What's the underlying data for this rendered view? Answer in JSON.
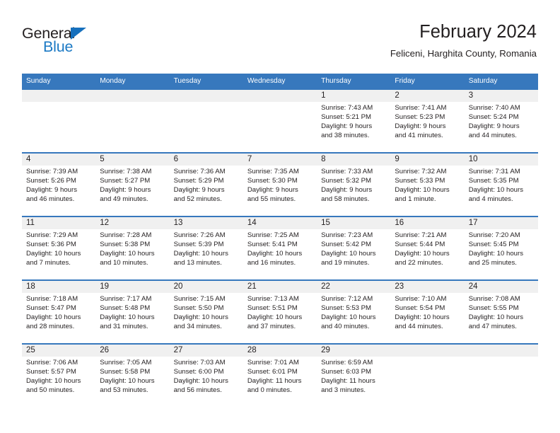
{
  "brand": {
    "name_part1": "General",
    "name_part2": "Blue",
    "logo_icon": "blue-triangle-icon",
    "accent_color": "#1b79c4"
  },
  "header": {
    "title": "February 2024",
    "subtitle": "Feliceni, Harghita County, Romania"
  },
  "calendar": {
    "header_bg_color": "#3778bd",
    "row_border_color": "#3778bd",
    "daynum_band_color": "#f0f0f0",
    "weekdays": [
      "Sunday",
      "Monday",
      "Tuesday",
      "Wednesday",
      "Thursday",
      "Friday",
      "Saturday"
    ],
    "weeks": [
      [
        {
          "day": "",
          "lines": []
        },
        {
          "day": "",
          "lines": []
        },
        {
          "day": "",
          "lines": []
        },
        {
          "day": "",
          "lines": []
        },
        {
          "day": "1",
          "lines": [
            "Sunrise: 7:43 AM",
            "Sunset: 5:21 PM",
            "Daylight: 9 hours",
            "and 38 minutes."
          ]
        },
        {
          "day": "2",
          "lines": [
            "Sunrise: 7:41 AM",
            "Sunset: 5:23 PM",
            "Daylight: 9 hours",
            "and 41 minutes."
          ]
        },
        {
          "day": "3",
          "lines": [
            "Sunrise: 7:40 AM",
            "Sunset: 5:24 PM",
            "Daylight: 9 hours",
            "and 44 minutes."
          ]
        }
      ],
      [
        {
          "day": "4",
          "lines": [
            "Sunrise: 7:39 AM",
            "Sunset: 5:26 PM",
            "Daylight: 9 hours",
            "and 46 minutes."
          ]
        },
        {
          "day": "5",
          "lines": [
            "Sunrise: 7:38 AM",
            "Sunset: 5:27 PM",
            "Daylight: 9 hours",
            "and 49 minutes."
          ]
        },
        {
          "day": "6",
          "lines": [
            "Sunrise: 7:36 AM",
            "Sunset: 5:29 PM",
            "Daylight: 9 hours",
            "and 52 minutes."
          ]
        },
        {
          "day": "7",
          "lines": [
            "Sunrise: 7:35 AM",
            "Sunset: 5:30 PM",
            "Daylight: 9 hours",
            "and 55 minutes."
          ]
        },
        {
          "day": "8",
          "lines": [
            "Sunrise: 7:33 AM",
            "Sunset: 5:32 PM",
            "Daylight: 9 hours",
            "and 58 minutes."
          ]
        },
        {
          "day": "9",
          "lines": [
            "Sunrise: 7:32 AM",
            "Sunset: 5:33 PM",
            "Daylight: 10 hours",
            "and 1 minute."
          ]
        },
        {
          "day": "10",
          "lines": [
            "Sunrise: 7:31 AM",
            "Sunset: 5:35 PM",
            "Daylight: 10 hours",
            "and 4 minutes."
          ]
        }
      ],
      [
        {
          "day": "11",
          "lines": [
            "Sunrise: 7:29 AM",
            "Sunset: 5:36 PM",
            "Daylight: 10 hours",
            "and 7 minutes."
          ]
        },
        {
          "day": "12",
          "lines": [
            "Sunrise: 7:28 AM",
            "Sunset: 5:38 PM",
            "Daylight: 10 hours",
            "and 10 minutes."
          ]
        },
        {
          "day": "13",
          "lines": [
            "Sunrise: 7:26 AM",
            "Sunset: 5:39 PM",
            "Daylight: 10 hours",
            "and 13 minutes."
          ]
        },
        {
          "day": "14",
          "lines": [
            "Sunrise: 7:25 AM",
            "Sunset: 5:41 PM",
            "Daylight: 10 hours",
            "and 16 minutes."
          ]
        },
        {
          "day": "15",
          "lines": [
            "Sunrise: 7:23 AM",
            "Sunset: 5:42 PM",
            "Daylight: 10 hours",
            "and 19 minutes."
          ]
        },
        {
          "day": "16",
          "lines": [
            "Sunrise: 7:21 AM",
            "Sunset: 5:44 PM",
            "Daylight: 10 hours",
            "and 22 minutes."
          ]
        },
        {
          "day": "17",
          "lines": [
            "Sunrise: 7:20 AM",
            "Sunset: 5:45 PM",
            "Daylight: 10 hours",
            "and 25 minutes."
          ]
        }
      ],
      [
        {
          "day": "18",
          "lines": [
            "Sunrise: 7:18 AM",
            "Sunset: 5:47 PM",
            "Daylight: 10 hours",
            "and 28 minutes."
          ]
        },
        {
          "day": "19",
          "lines": [
            "Sunrise: 7:17 AM",
            "Sunset: 5:48 PM",
            "Daylight: 10 hours",
            "and 31 minutes."
          ]
        },
        {
          "day": "20",
          "lines": [
            "Sunrise: 7:15 AM",
            "Sunset: 5:50 PM",
            "Daylight: 10 hours",
            "and 34 minutes."
          ]
        },
        {
          "day": "21",
          "lines": [
            "Sunrise: 7:13 AM",
            "Sunset: 5:51 PM",
            "Daylight: 10 hours",
            "and 37 minutes."
          ]
        },
        {
          "day": "22",
          "lines": [
            "Sunrise: 7:12 AM",
            "Sunset: 5:53 PM",
            "Daylight: 10 hours",
            "and 40 minutes."
          ]
        },
        {
          "day": "23",
          "lines": [
            "Sunrise: 7:10 AM",
            "Sunset: 5:54 PM",
            "Daylight: 10 hours",
            "and 44 minutes."
          ]
        },
        {
          "day": "24",
          "lines": [
            "Sunrise: 7:08 AM",
            "Sunset: 5:55 PM",
            "Daylight: 10 hours",
            "and 47 minutes."
          ]
        }
      ],
      [
        {
          "day": "25",
          "lines": [
            "Sunrise: 7:06 AM",
            "Sunset: 5:57 PM",
            "Daylight: 10 hours",
            "and 50 minutes."
          ]
        },
        {
          "day": "26",
          "lines": [
            "Sunrise: 7:05 AM",
            "Sunset: 5:58 PM",
            "Daylight: 10 hours",
            "and 53 minutes."
          ]
        },
        {
          "day": "27",
          "lines": [
            "Sunrise: 7:03 AM",
            "Sunset: 6:00 PM",
            "Daylight: 10 hours",
            "and 56 minutes."
          ]
        },
        {
          "day": "28",
          "lines": [
            "Sunrise: 7:01 AM",
            "Sunset: 6:01 PM",
            "Daylight: 11 hours",
            "and 0 minutes."
          ]
        },
        {
          "day": "29",
          "lines": [
            "Sunrise: 6:59 AM",
            "Sunset: 6:03 PM",
            "Daylight: 11 hours",
            "and 3 minutes."
          ]
        },
        {
          "day": "",
          "lines": []
        },
        {
          "day": "",
          "lines": []
        }
      ]
    ]
  }
}
